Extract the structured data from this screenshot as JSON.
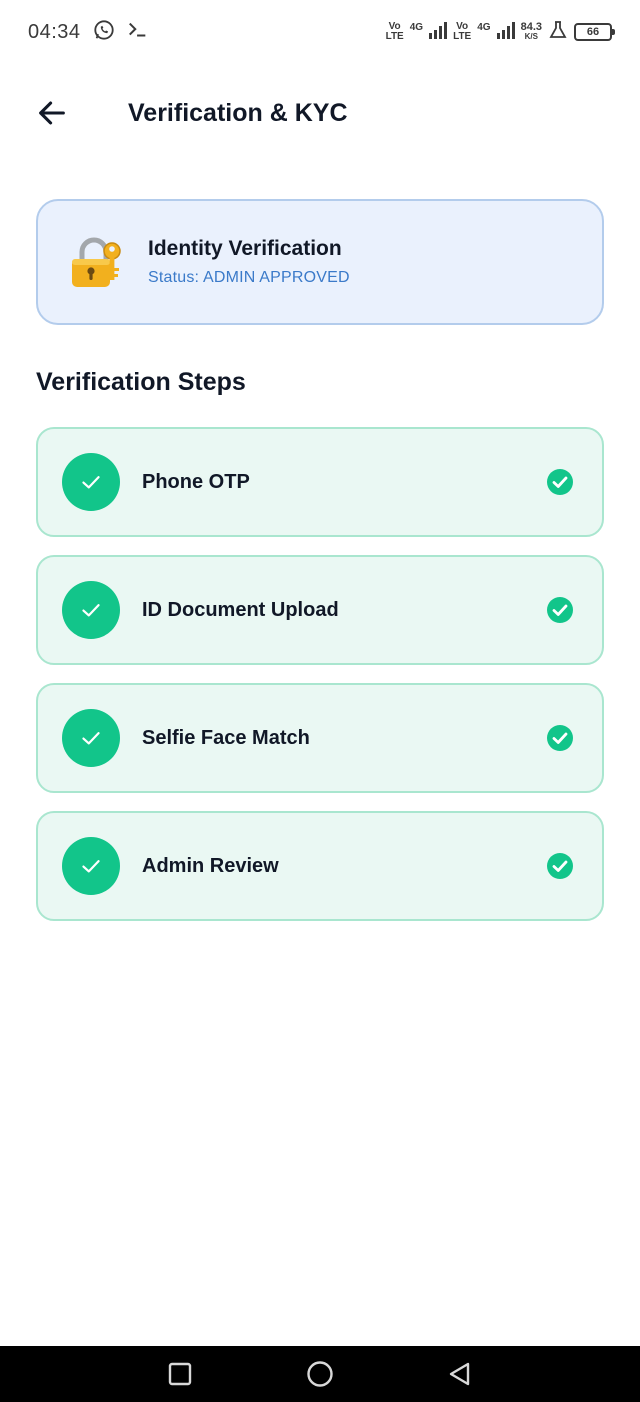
{
  "status_bar": {
    "time": "04:34",
    "sim1_top": "Vo",
    "sim1_bottom": "LTE",
    "sim1_net": "4G",
    "sim2_top": "Vo",
    "sim2_bottom": "LTE",
    "sim2_net": "4G",
    "speed_value": "84.3",
    "speed_unit": "K/S",
    "battery": "66",
    "icons": [
      "whatsapp-icon",
      "terminal-icon",
      "signal-icon",
      "signal-icon",
      "lab-flask-icon",
      "battery-icon"
    ]
  },
  "app_bar": {
    "title": "Verification & KYC",
    "back_icon": "arrow-left-icon"
  },
  "identity_card": {
    "title": "Identity Verification",
    "status_prefix": "Status: ",
    "status_value": "ADMIN APPROVED",
    "icon": "locked-with-key-icon"
  },
  "steps_section": {
    "title": "Verification Steps",
    "steps": [
      {
        "label": "Phone OTP",
        "completed": true
      },
      {
        "label": "ID Document Upload",
        "completed": true
      },
      {
        "label": "Selfie Face Match",
        "completed": true
      },
      {
        "label": "Admin Review",
        "completed": true
      }
    ]
  },
  "colors": {
    "accent_green": "#12c58a",
    "card_green_bg": "#eaf8f3",
    "card_blue_bg": "#eaf1fd",
    "status_blue": "#3b7ac9"
  },
  "nav_bar": {
    "buttons": [
      "recents-square-icon",
      "home-circle-icon",
      "back-triangle-icon"
    ]
  }
}
